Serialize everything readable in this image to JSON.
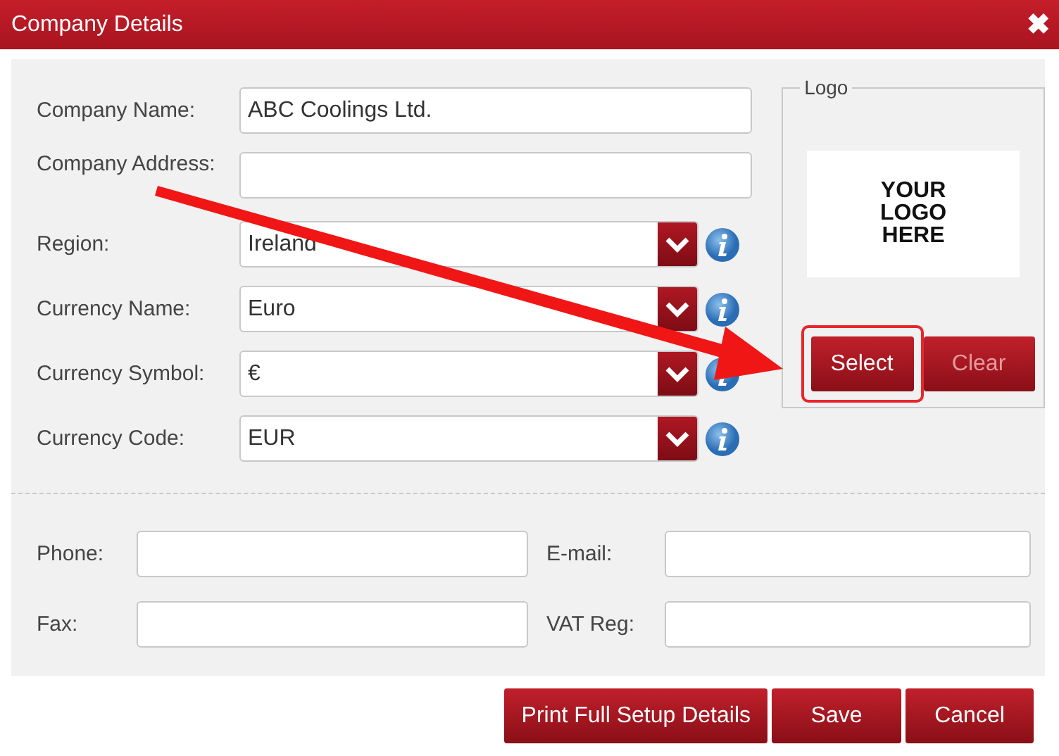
{
  "window": {
    "title": "Company Details",
    "close": "✖"
  },
  "fields": [
    {
      "kind": "text",
      "label": "Company Name:",
      "value": "ABC Coolings Ltd."
    },
    {
      "kind": "text",
      "label": "Company Address:"
    },
    {
      "kind": "select",
      "label": "Region:",
      "value": "Ireland"
    },
    {
      "kind": "select",
      "label": "Currency Name:",
      "value": "Euro"
    },
    {
      "kind": "select",
      "label": "Currency Symbol:",
      "value": "€"
    },
    {
      "kind": "select",
      "label": "Currency Code:",
      "value": "EUR"
    }
  ],
  "logo": {
    "legend": "Logo",
    "placeholder_lines": [
      "YOUR",
      "LOGO",
      "HERE"
    ],
    "buttons": [
      {
        "label": "Select",
        "disabled": false,
        "highlighted": true
      },
      {
        "label": "Clear",
        "disabled": true,
        "highlighted": false
      }
    ]
  },
  "contact": [
    {
      "label": "Phone:"
    },
    {
      "label": "E-mail:"
    },
    {
      "label": "Fax:"
    },
    {
      "label": "VAT Reg:"
    }
  ],
  "buttons": [
    "Print Full Setup Details",
    "Save",
    "Cancel"
  ]
}
